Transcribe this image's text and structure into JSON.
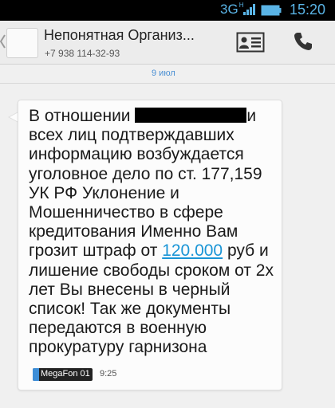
{
  "status_bar": {
    "network": "3G",
    "network_sup": "H",
    "time": "15:20",
    "accent_color": "#5ab4e6"
  },
  "header": {
    "contact_name": "Непонятная Организ...",
    "contact_phone": "+7 938 114-32-93",
    "icons": [
      "back-chevron-icon",
      "avatar",
      "contact-card-icon",
      "phone-call-icon"
    ]
  },
  "conversation": {
    "date": "9 июл",
    "message": {
      "lines": [
        {
          "pre": "В отношении ",
          "redacted": true,
          "post": "и"
        },
        {
          "text": "всех лиц подтверждавших"
        },
        {
          "text": "информацию возбуждается"
        },
        {
          "text": "уголовное дело по ст. 177,159"
        },
        {
          "text": "УК РФ Уклонение и"
        },
        {
          "text": "Мошенничество в сфере"
        },
        {
          "text": "кредитования Именно Вам"
        },
        {
          "pre": "грозит штраф от ",
          "link": "120.000",
          "post": " руб и"
        },
        {
          "text": "лишение свободы сроком от 2х"
        },
        {
          "text": "лет Вы внесены в черный"
        },
        {
          "text": "список! Так же документы"
        },
        {
          "text": "передаются в военную"
        },
        {
          "text": "прокуратуру гарнизона"
        }
      ],
      "sim_label": "MegaFon 01",
      "time": "9:25",
      "link_color": "#1a95d6"
    }
  }
}
